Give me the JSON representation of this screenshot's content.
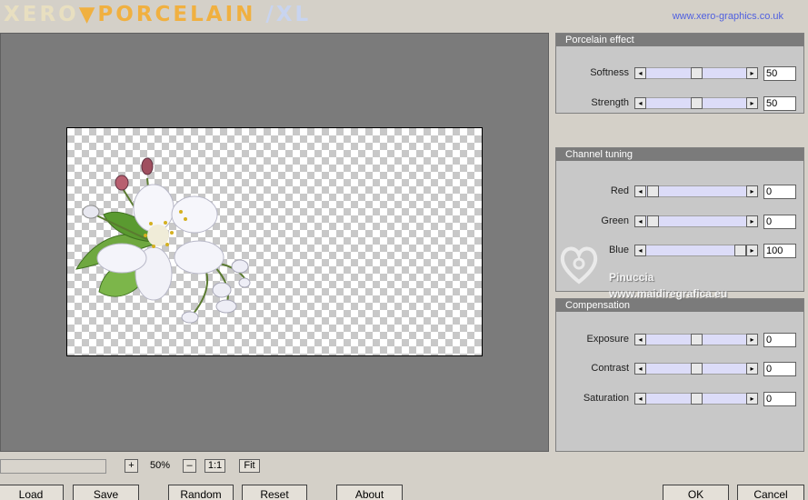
{
  "header": {
    "logo_left": "XERO",
    "logo_mid": "▼PORCELAIN",
    "logo_right": "/XL",
    "url": "www.xero-graphics.co.uk"
  },
  "groups": {
    "porcelain": {
      "title": "Porcelain effect",
      "softness": {
        "label": "Softness",
        "value": "50"
      },
      "strength": {
        "label": "Strength",
        "value": "50"
      }
    },
    "channel": {
      "title": "Channel tuning",
      "red": {
        "label": "Red",
        "value": "0"
      },
      "green": {
        "label": "Green",
        "value": "0"
      },
      "blue": {
        "label": "Blue",
        "value": "100"
      }
    },
    "compensation": {
      "title": "Compensation",
      "exposure": {
        "label": "Exposure",
        "value": "0"
      },
      "contrast": {
        "label": "Contrast",
        "value": "0"
      },
      "saturation": {
        "label": "Saturation",
        "value": "0"
      }
    }
  },
  "slider_levels": {
    "softness": 0.5,
    "strength": 0.5,
    "red": 0.0,
    "green": 0.0,
    "blue": 1.0,
    "exposure": 0.5,
    "contrast": 0.5,
    "saturation": 0.5
  },
  "watermark": {
    "name": "Pinuccia",
    "site": "www.maidiregrafica.eu"
  },
  "zoom": {
    "plus": "+",
    "value": "50%",
    "minus": "–",
    "one_to_one": "1:1",
    "fit": "Fit"
  },
  "buttons": {
    "load": "Load",
    "save": "Save",
    "random": "Random",
    "reset": "Reset",
    "about": "About",
    "ok": "OK",
    "cancel": "Cancel"
  },
  "colors": {
    "slider_track": "#dcdcf8",
    "url": "#5060e0",
    "preview_bg": "#7b7b7b"
  }
}
